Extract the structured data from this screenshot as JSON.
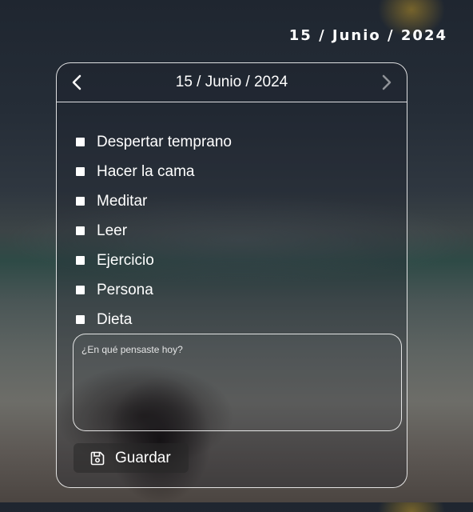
{
  "top_date": "15 / Junio / 2024",
  "calendar": {
    "date": "15 / Junio / 2024",
    "prev_icon": "chevron-left-icon",
    "next_icon": "chevron-right-icon"
  },
  "tasks": [
    {
      "label": "Despertar temprano",
      "checked": false
    },
    {
      "label": "Hacer la cama",
      "checked": false
    },
    {
      "label": "Meditar",
      "checked": false
    },
    {
      "label": "Leer",
      "checked": false
    },
    {
      "label": "Ejercicio",
      "checked": false
    },
    {
      "label": "Persona",
      "checked": false
    },
    {
      "label": "Dieta",
      "checked": false
    }
  ],
  "note": {
    "placeholder": "¿En qué pensaste hoy?",
    "value": ""
  },
  "save": {
    "label": "Guardar",
    "icon": "save-icon"
  }
}
